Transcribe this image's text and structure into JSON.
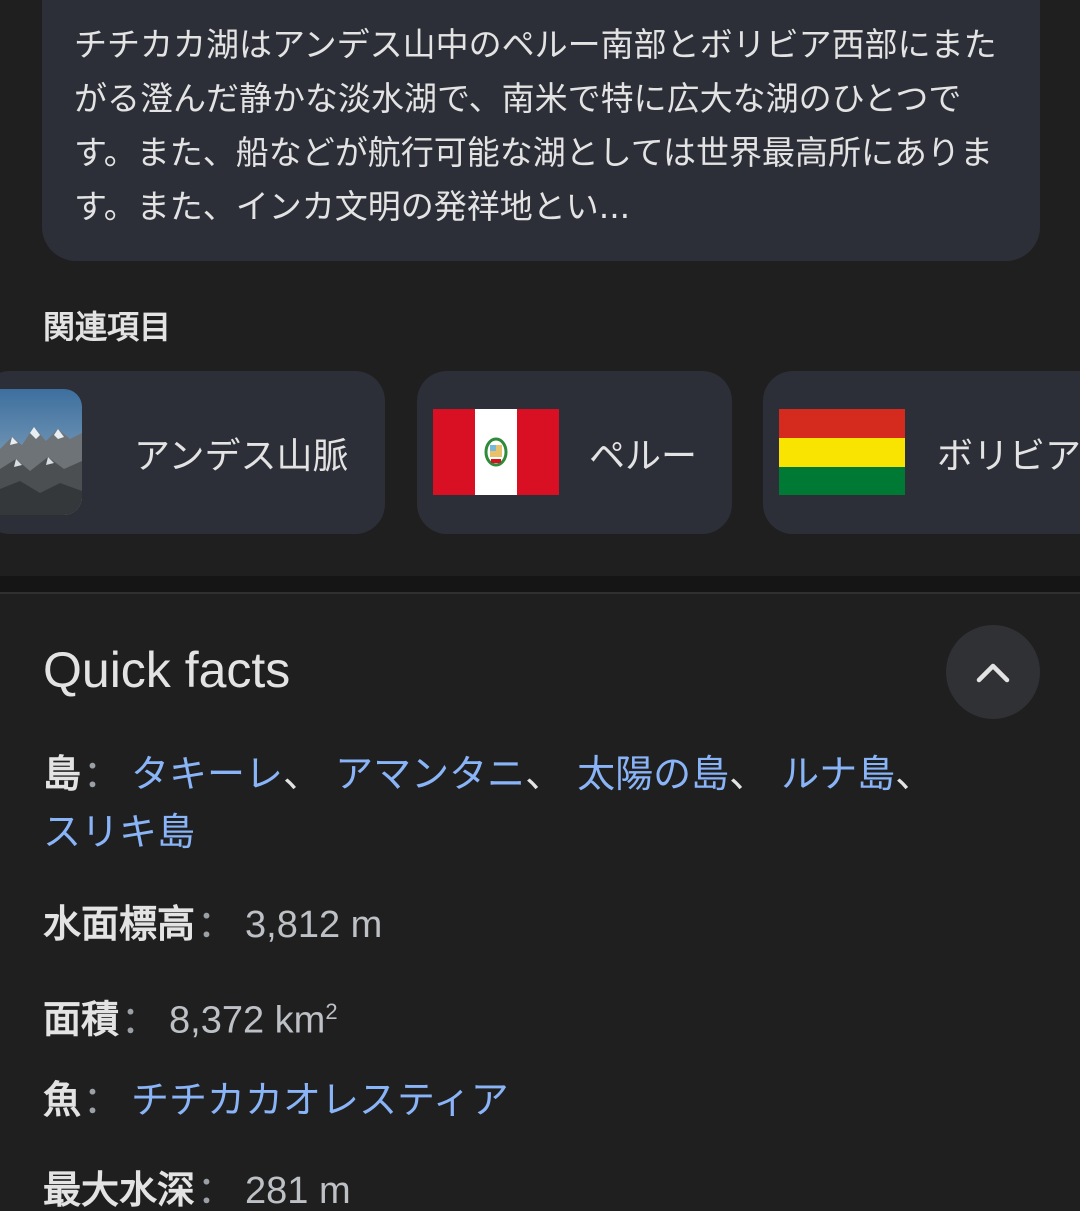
{
  "description": {
    "text": "チチカカ湖はアンデス山中のペルー南部とボリビア西部にまたがる澄んだ静かな淡水湖で、南米で特に広大な湖のひとつです。また、船などが航行可能な湖としては世界最高所にあります。また、インカ文明の発祥地とい..."
  },
  "related": {
    "heading": "関連項目",
    "items": [
      {
        "label": "アンデス山脈",
        "icon": "mountain-photo"
      },
      {
        "label": "ペルー",
        "icon": "peru-flag"
      },
      {
        "label": "ボリビア",
        "icon": "bolivia-flag"
      }
    ]
  },
  "quick_facts": {
    "title": "Quick facts",
    "collapse_icon": "chevron-up-icon",
    "separator": "：",
    "islands": {
      "label": "島",
      "links": [
        "タキーレ",
        "アマンタニ",
        "太陽の島",
        "ルナ島",
        "スリキ島"
      ],
      "comma": "、"
    },
    "elevation": {
      "label": "水面標高",
      "value": "3,812 m"
    },
    "area": {
      "label": "面積",
      "value": "8,372 km",
      "sup": "2"
    },
    "fish": {
      "label": "魚",
      "link": "チチカカオレスティア"
    },
    "max_depth": {
      "label": "最大水深",
      "value": "281 m"
    }
  },
  "colors": {
    "background": "#1f1f1f",
    "card": "#2c2f38",
    "link": "#8ab4f8",
    "text": "#e3e3e3"
  }
}
